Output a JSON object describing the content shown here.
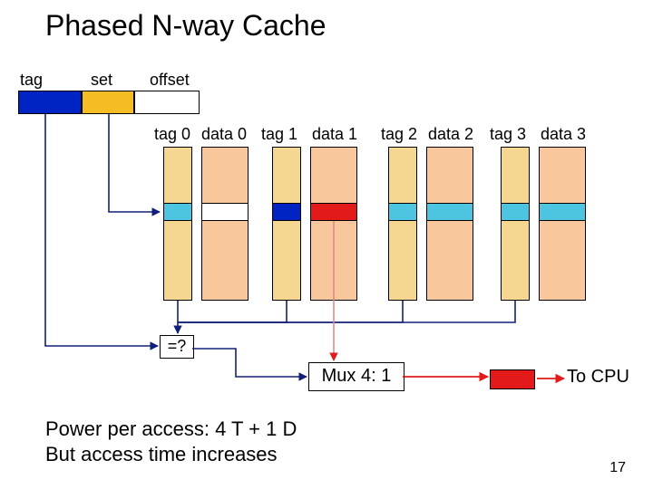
{
  "title": "Phased N-way Cache",
  "labels": {
    "tag": "tag",
    "set": "set",
    "offset": "offset",
    "tag0": "tag 0",
    "data0": "data 0",
    "tag1": "tag 1",
    "data1": "data 1",
    "tag2": "tag 2",
    "data2": "data 2",
    "tag3": "tag 3",
    "data3": "data 3",
    "eq": "=?",
    "mux": "Mux 4: 1",
    "tocpu": "To CPU"
  },
  "footnote_line1": "Power per access: 4 T + 1 D",
  "footnote_line2": "But access time increases",
  "slide_number": "17",
  "colors": {
    "tan": "#F6D791",
    "peach": "#F8C79B",
    "blue": "#0023C4",
    "amber": "#F5BC24",
    "cyan": "#4EC5E0",
    "red": "#E21A1A"
  }
}
